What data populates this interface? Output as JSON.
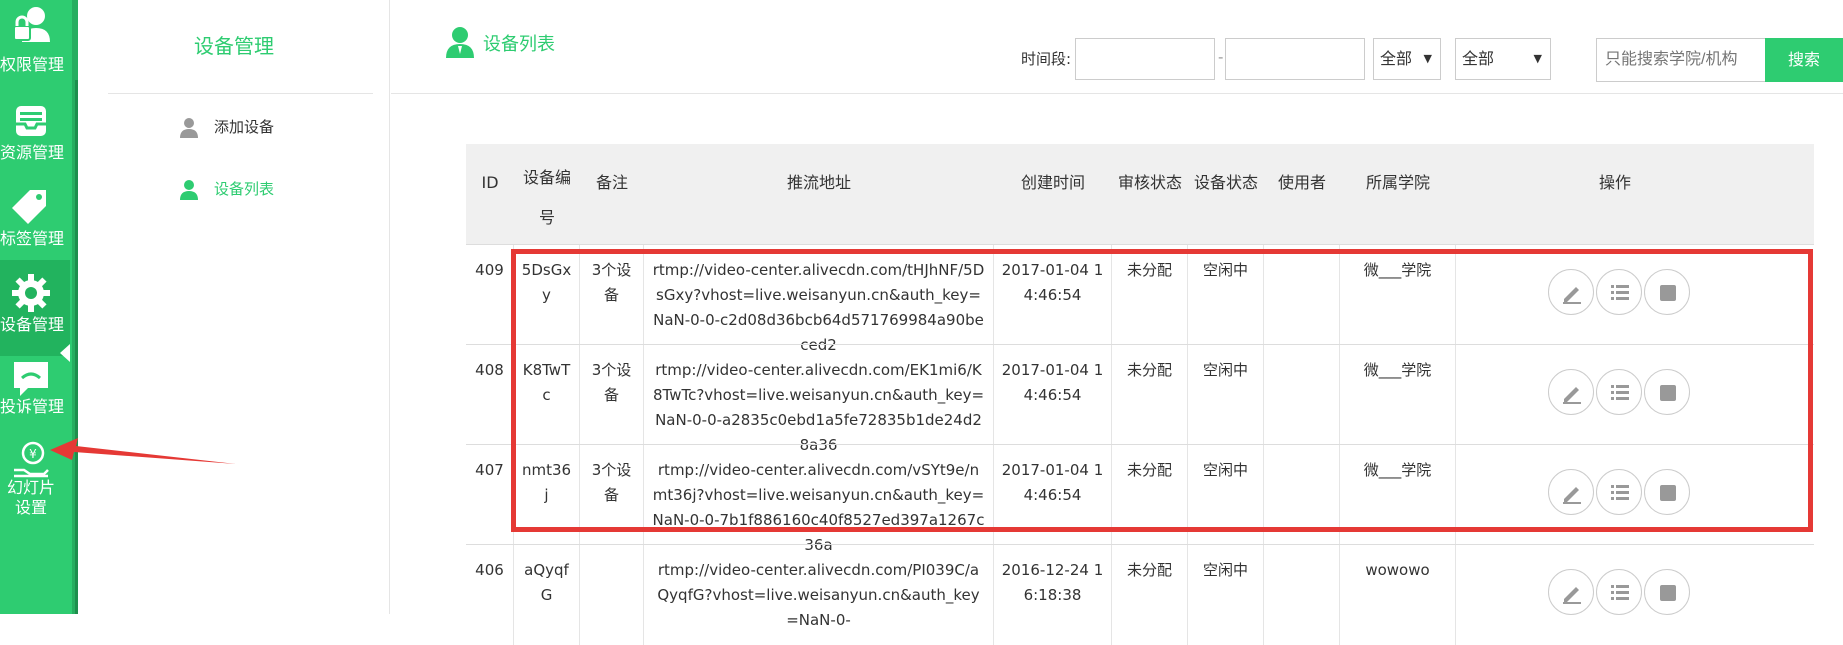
{
  "left_nav": {
    "items": [
      {
        "label": "权限管理",
        "icon": "user-lock-icon"
      },
      {
        "label": "资源管理",
        "icon": "inbox-icon"
      },
      {
        "label": "标签管理",
        "icon": "tag-icon"
      },
      {
        "label": "设备管理",
        "icon": "gear-icon",
        "active": true
      },
      {
        "label": "投诉管理",
        "icon": "chat-icon"
      },
      {
        "label": "幻灯片设置",
        "icon": "yen-hand-icon"
      }
    ]
  },
  "sub_nav": {
    "title": "设备管理",
    "items": [
      {
        "label": "添加设备",
        "active": false
      },
      {
        "label": "设备列表",
        "active": true
      }
    ]
  },
  "page": {
    "title": "设备列表"
  },
  "filters": {
    "time_label": "时间段:",
    "date_from": "",
    "date_to": "",
    "separator": "-",
    "select1": "全部",
    "select2": "全部",
    "search_placeholder": "只能搜索学院/机构",
    "search_button": "搜索"
  },
  "table": {
    "headers": [
      "ID",
      "设备编号",
      "备注",
      "推流地址",
      "创建时间",
      "审核状态",
      "设备状态",
      "使用者",
      "所属学院",
      "操作"
    ],
    "rows": [
      {
        "id": "409",
        "code": "5DsGxy",
        "note": "3个设备",
        "url": "rtmp://video-center.alivecdn.com/tHJhNF/5DsGxy?vhost=live.weisanyun.cn&auth_key=NaN-0-0-c2d08d36bcb64d571769984a90beced2",
        "created": "2017-01-04 14:46:54",
        "audit": "未分配",
        "status": "空闲中",
        "user": "",
        "college": "微___学院"
      },
      {
        "id": "408",
        "code": "K8TwTc",
        "note": "3个设备",
        "url": "rtmp://video-center.alivecdn.com/EK1mi6/K8TwTc?vhost=live.weisanyun.cn&auth_key=NaN-0-0-a2835c0ebd1a5fe72835b1de24d28a36",
        "created": "2017-01-04 14:46:54",
        "audit": "未分配",
        "status": "空闲中",
        "user": "",
        "college": "微___学院"
      },
      {
        "id": "407",
        "code": "nmt36j",
        "note": "3个设备",
        "url": "rtmp://video-center.alivecdn.com/vSYt9e/nmt36j?vhost=live.weisanyun.cn&auth_key=NaN-0-0-7b1f886160c40f8527ed397a1267c36a",
        "created": "2017-01-04 14:46:54",
        "audit": "未分配",
        "status": "空闲中",
        "user": "",
        "college": "微___学院"
      },
      {
        "id": "406",
        "code": "aQyqfG",
        "note": "",
        "url": "rtmp://video-center.alivecdn.com/PI039C/aQyqfG?vhost=live.weisanyun.cn&auth_key=NaN-0-",
        "created": "2016-12-24 16:18:38",
        "audit": "未分配",
        "status": "空闲中",
        "user": "",
        "college": "wowowo"
      }
    ],
    "row_actions": [
      "edit-icon",
      "list-icon",
      "stop-icon"
    ]
  },
  "colors": {
    "brand_green": "#2ecc71",
    "highlight_red": "#e53935"
  }
}
